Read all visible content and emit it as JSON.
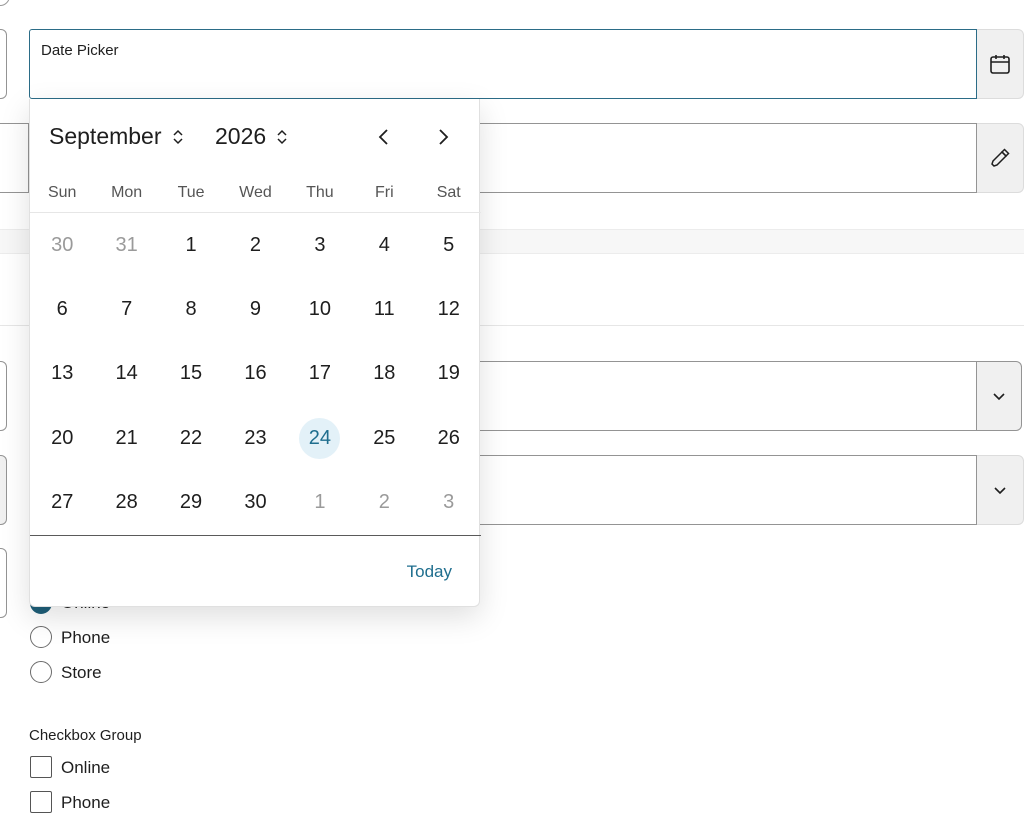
{
  "date_picker": {
    "label": "Date Picker",
    "value": "",
    "icon": "calendar-icon"
  },
  "color_field": {
    "icon": "eyedropper-icon"
  },
  "select_1": {
    "icon": "chevron-down-icon"
  },
  "select_2": {
    "icon": "chevron-down-icon"
  },
  "radio_group": {
    "options": [
      {
        "label": "Online",
        "checked": true
      },
      {
        "label": "Phone",
        "checked": false
      },
      {
        "label": "Store",
        "checked": false
      }
    ]
  },
  "checkbox_group": {
    "label": "Checkbox Group",
    "options": [
      {
        "label": "Online",
        "checked": false
      },
      {
        "label": "Phone",
        "checked": false
      }
    ]
  },
  "calendar": {
    "month": "September",
    "year": "2026",
    "weekdays": [
      "Sun",
      "Mon",
      "Tue",
      "Wed",
      "Thu",
      "Fri",
      "Sat"
    ],
    "weeks": [
      [
        "30",
        "31",
        "1",
        "2",
        "3",
        "4",
        "5"
      ],
      [
        "6",
        "7",
        "8",
        "9",
        "10",
        "11",
        "12"
      ],
      [
        "13",
        "14",
        "15",
        "16",
        "17",
        "18",
        "19"
      ],
      [
        "20",
        "21",
        "22",
        "23",
        "24",
        "25",
        "26"
      ],
      [
        "27",
        "28",
        "29",
        "30",
        "1",
        "2",
        "3"
      ]
    ],
    "outside_month": [
      [
        0,
        0
      ],
      [
        0,
        1
      ],
      [
        4,
        4
      ],
      [
        4,
        5
      ],
      [
        4,
        6
      ]
    ],
    "selected_day": "24",
    "today_label": "Today",
    "accent_color": "#1f6e8e",
    "selected_bg": "#e3f1f8"
  }
}
